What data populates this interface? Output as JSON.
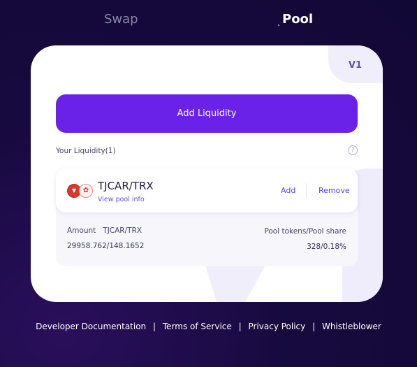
{
  "tabs": {
    "swap": "Swap",
    "pool": "Pool"
  },
  "card": {
    "version_label": "V1",
    "add_liquidity_label": "Add Liquidity",
    "your_liquidity_label": "Your Liquidity(1)",
    "help_icon": "?"
  },
  "pool": {
    "pair_name": "TJCAR/TRX",
    "view_info_label": "View pool info",
    "add_label": "Add",
    "remove_label": "Remove",
    "amount_label": "Amount   TJCAR/TRX",
    "amount_value": "29958.762/148.1652",
    "share_label": "Pool tokens/Pool share",
    "share_value": "328/0.18%",
    "token_logos": [
      "tron-red-logo",
      "tjcar-logo"
    ]
  },
  "footer": {
    "links": [
      "Developer Documentation",
      "Terms of Service",
      "Privacy Policy",
      "Whistleblower"
    ],
    "separator": "|"
  },
  "colors": {
    "background": "#170a3f",
    "accent": "#6a22e8",
    "link": "#5a3fd6"
  }
}
